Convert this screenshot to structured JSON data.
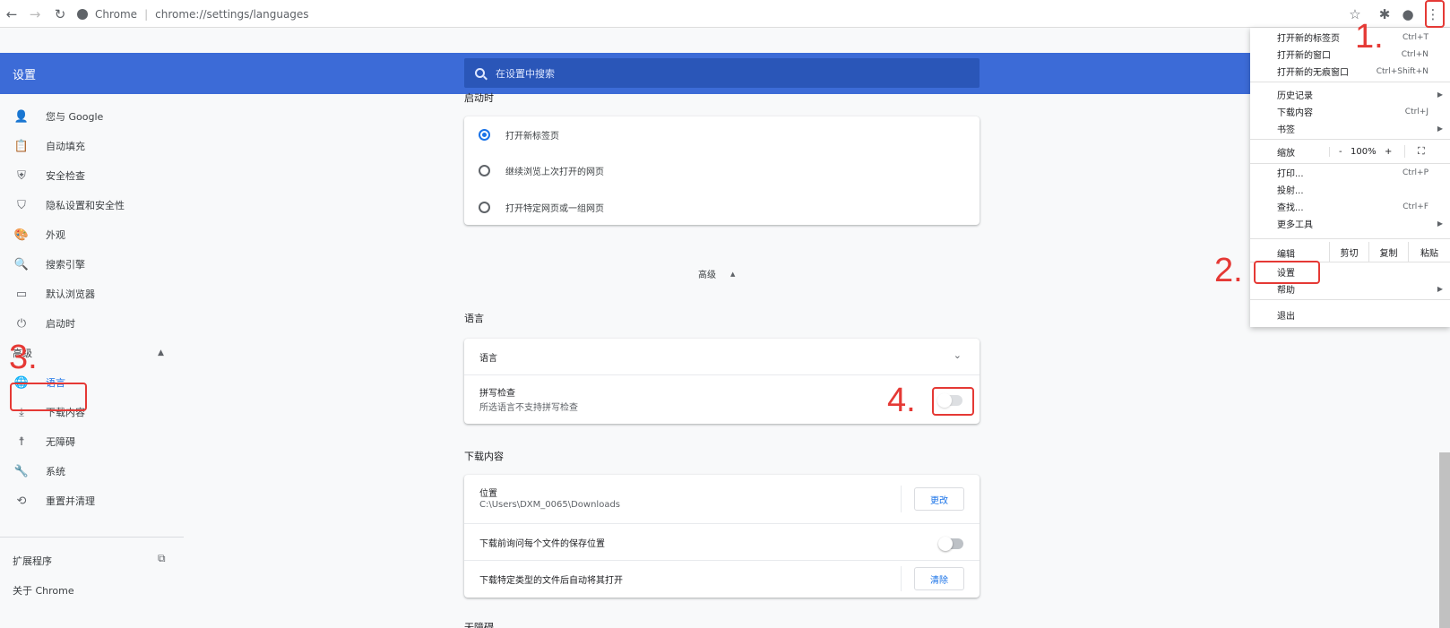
{
  "browser": {
    "site_label": "Chrome",
    "url": "chrome://settings/languages",
    "back_icon": "back-arrow-icon",
    "forward_icon": "forward-arrow-icon",
    "reload_icon": "reload-icon"
  },
  "settings": {
    "title": "设置",
    "search_placeholder": "在设置中搜索"
  },
  "sidebar": {
    "items": [
      {
        "label": "您与 Google",
        "icon": "person-icon"
      },
      {
        "label": "自动填充",
        "icon": "clipboard-icon"
      },
      {
        "label": "安全检查",
        "icon": "shield-check-icon"
      },
      {
        "label": "隐私设置和安全性",
        "icon": "shield-icon"
      },
      {
        "label": "外观",
        "icon": "palette-icon"
      },
      {
        "label": "搜索引擎",
        "icon": "search-icon"
      },
      {
        "label": "默认浏览器",
        "icon": "browser-icon"
      },
      {
        "label": "启动时",
        "icon": "power-icon"
      }
    ],
    "advanced_label": "高级",
    "advanced_items": [
      {
        "label": "语言",
        "icon": "globe-icon"
      },
      {
        "label": "下载内容",
        "icon": "download-icon"
      },
      {
        "label": "无障碍",
        "icon": "accessibility-icon"
      },
      {
        "label": "系统",
        "icon": "wrench-icon"
      },
      {
        "label": "重置并清理",
        "icon": "restore-icon"
      }
    ],
    "extensions_label": "扩展程序",
    "about_label": "关于 Chrome"
  },
  "main": {
    "startup_header": "启动时",
    "startup_options": [
      {
        "label": "打开新标签页",
        "checked": true
      },
      {
        "label": "继续浏览上次打开的网页",
        "checked": false
      },
      {
        "label": "打开特定网页或一组网页",
        "checked": false
      }
    ],
    "advanced_toggle": "高级",
    "languages_header": "语言",
    "languages_row": "语言",
    "spellcheck_title": "拼写检查",
    "spellcheck_sub": "所选语言不支持拼写检查",
    "downloads_header": "下载内容",
    "location_title": "位置",
    "location_path": "C:\\Users\\DXM_0065\\Downloads",
    "change_button": "更改",
    "ask_where_label": "下载前询问每个文件的保存位置",
    "auto_open_label": "下载特定类型的文件后自动将其打开",
    "clear_button": "清除",
    "accessibility_header": "无障碍"
  },
  "menu": {
    "new_tab": {
      "label": "打开新的标签页",
      "shortcut": "Ctrl+T"
    },
    "new_window": {
      "label": "打开新的窗口",
      "shortcut": "Ctrl+N"
    },
    "incognito": {
      "label": "打开新的无痕窗口",
      "shortcut": "Ctrl+Shift+N"
    },
    "history": {
      "label": "历史记录"
    },
    "downloads": {
      "label": "下载内容",
      "shortcut": "Ctrl+J"
    },
    "bookmarks": {
      "label": "书签"
    },
    "zoom_label": "缩放",
    "zoom_minus": "-",
    "zoom_value": "100%",
    "zoom_plus": "+",
    "print": {
      "label": "打印...",
      "shortcut": "Ctrl+P"
    },
    "cast": {
      "label": "投射..."
    },
    "find": {
      "label": "查找...",
      "shortcut": "Ctrl+F"
    },
    "more_tools": {
      "label": "更多工具"
    },
    "edit_label": "编辑",
    "cut": "剪切",
    "copy": "复制",
    "paste": "粘贴",
    "settings": {
      "label": "设置"
    },
    "help": {
      "label": "帮助"
    },
    "exit": {
      "label": "退出"
    }
  },
  "annotations": {
    "n1": "1.",
    "n2": "2.",
    "n3": "3.",
    "n4": "4.",
    "color": "#e53935"
  }
}
